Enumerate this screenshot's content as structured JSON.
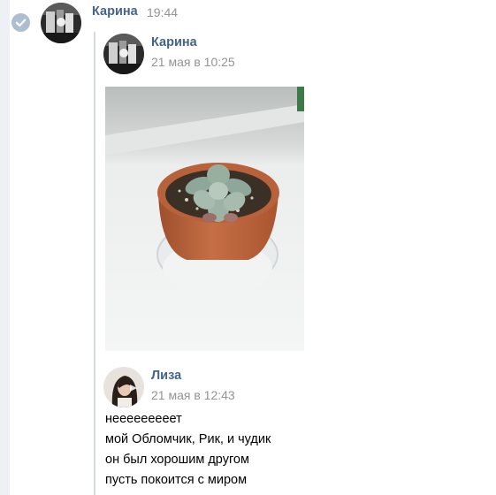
{
  "message": {
    "author": "Карина",
    "time": "19:44"
  },
  "forwarded": [
    {
      "author": "Карина",
      "date": "21 мая в 10:25",
      "attachment": "succulent-photo"
    },
    {
      "author": "Лиза",
      "date": "21 мая в 12:43",
      "lines": [
        "нееееееееет",
        "мой Обломчик, Рик, и чудик",
        "он был хорошим другом",
        "пусть покоится с миром"
      ]
    }
  ],
  "colors": {
    "author_name": "#42648b",
    "timestamp": "#939393",
    "check_badge": "#aebdcf",
    "forward_line": "#d3d9de"
  }
}
